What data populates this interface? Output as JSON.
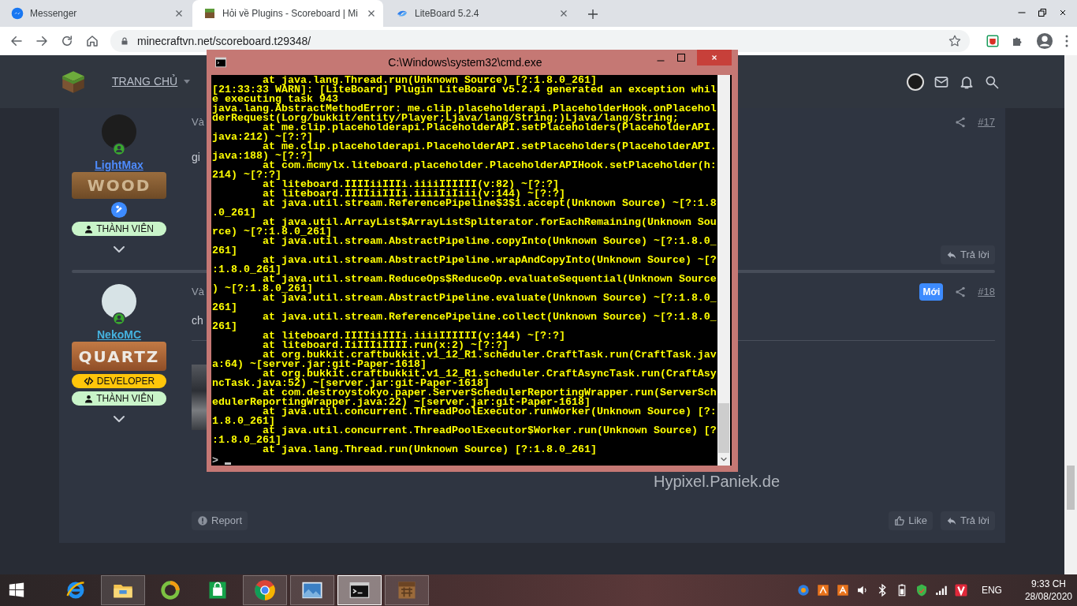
{
  "browser": {
    "tabs": [
      {
        "title": "Messenger",
        "selected": false
      },
      {
        "title": "Hỏi về Plugins - Scoreboard | Mi",
        "selected": true
      },
      {
        "title": "LiteBoard 5.2.4",
        "selected": false
      }
    ],
    "url": "minecraftvn.net/scoreboard.t29348/"
  },
  "site": {
    "nav_items": [
      {
        "label": "TRANG CHỦ"
      }
    ]
  },
  "posts": [
    {
      "author": "LightMax",
      "color": "#4e8cff",
      "online": true,
      "banner": {
        "kind": "wood",
        "text": "WOOD"
      },
      "writer_icon": true,
      "badges": [
        {
          "kind": "member",
          "label": "THÀNH VIÊN"
        }
      ],
      "meta": "Và",
      "is_new": false,
      "number": "#17",
      "body": "gi",
      "attachment_image": false,
      "actions": [
        {
          "kind": "reply",
          "label": "Trả lời"
        }
      ]
    },
    {
      "author": "NekoMC",
      "color": "#45b3e0",
      "online": true,
      "banner": {
        "kind": "quartz",
        "text": "QUARTZ"
      },
      "writer_icon": false,
      "badges": [
        {
          "kind": "developer",
          "label": "DEVELOPER"
        },
        {
          "kind": "member",
          "label": "THÀNH VIÊN"
        }
      ],
      "meta": "Và",
      "is_new": true,
      "new_label": "Mới",
      "number": "#18",
      "body": "ch",
      "attachment_image": true,
      "signature": "Hypixel.Paniek.de",
      "actions": [
        {
          "kind": "report",
          "label": "Report"
        },
        {
          "kind": "like",
          "label": "Like"
        },
        {
          "kind": "reply",
          "label": "Trả lời"
        }
      ]
    }
  ],
  "console_window": {
    "title": "C:\\Windows\\system32\\cmd.exe",
    "prompt": ">",
    "lines": [
      {
        "text": "at java.lang.Thread.run(Unknown Source) [?:1.8.0_261]",
        "indented": true
      },
      {
        "text": "[21:33:33 WARN]: [LiteBoard] Plugin LiteBoard v5.2.4 generated an exception whil",
        "indented": false
      },
      {
        "text": "e executing task 943",
        "indented": false
      },
      {
        "text": "java.lang.AbstractMethodError: me.clip.placeholderapi.PlaceholderHook.onPlacehol",
        "indented": false
      },
      {
        "text": "derRequest(Lorg/bukkit/entity/Player;Ljava/lang/String;)Ljava/lang/String;",
        "indented": false
      },
      {
        "text": "at me.clip.placeholderapi.PlaceholderAPI.setPlaceholders(PlaceholderAPI.",
        "indented": true
      },
      {
        "text": "java:212) ~[?:?]",
        "indented": false
      },
      {
        "text": "at me.clip.placeholderapi.PlaceholderAPI.setPlaceholders(PlaceholderAPI.",
        "indented": true
      },
      {
        "text": "java:188) ~[?:?]",
        "indented": false
      },
      {
        "text": "at com.mcmylx.liteboard.placeholder.PlaceholderAPIHook.setPlaceholder(h:",
        "indented": true
      },
      {
        "text": "214) ~[?:?]",
        "indented": false
      },
      {
        "text": "at liteboard.IIIIiiIIIi.iiiiIIIIII(v:82) ~[?:?]",
        "indented": true
      },
      {
        "text": "at liteboard.IIIIiiIIIi.iiiiIiIiii(v:144) ~[?:?]",
        "indented": true
      },
      {
        "text": "at java.util.stream.ReferencePipeline$3$1.accept(Unknown Source) ~[?:1.8",
        "indented": true
      },
      {
        "text": ".0_261]",
        "indented": false
      },
      {
        "text": "at java.util.ArrayList$ArrayListSpliterator.forEachRemaining(Unknown Sou",
        "indented": true
      },
      {
        "text": "rce) ~[?:1.8.0_261]",
        "indented": false
      },
      {
        "text": "at java.util.stream.AbstractPipeline.copyInto(Unknown Source) ~[?:1.8.0_",
        "indented": true
      },
      {
        "text": "261]",
        "indented": false
      },
      {
        "text": "at java.util.stream.AbstractPipeline.wrapAndCopyInto(Unknown Source) ~[?",
        "indented": true
      },
      {
        "text": ":1.8.0_261]",
        "indented": false
      },
      {
        "text": "at java.util.stream.ReduceOps$ReduceOp.evaluateSequential(Unknown Source",
        "indented": true
      },
      {
        "text": ") ~[?:1.8.0_261]",
        "indented": false
      },
      {
        "text": "at java.util.stream.AbstractPipeline.evaluate(Unknown Source) ~[?:1.8.0_",
        "indented": true
      },
      {
        "text": "261]",
        "indented": false
      },
      {
        "text": "at java.util.stream.ReferencePipeline.collect(Unknown Source) ~[?:1.8.0_",
        "indented": true
      },
      {
        "text": "261]",
        "indented": false
      },
      {
        "text": "at liteboard.IIIIiiIIIi.iiiiIIIIII(v:144) ~[?:?]",
        "indented": true
      },
      {
        "text": "at liteboard.IiIIIiIIII.run(x:2) ~[?:?]",
        "indented": true
      },
      {
        "text": "at org.bukkit.craftbukkit.v1_12_R1.scheduler.CraftTask.run(CraftTask.jav",
        "indented": true
      },
      {
        "text": "a:64) ~[server.jar:git-Paper-1618]",
        "indented": false
      },
      {
        "text": "at org.bukkit.craftbukkit.v1_12_R1.scheduler.CraftAsyncTask.run(CraftAsy",
        "indented": true
      },
      {
        "text": "ncTask.java:52) ~[server.jar:git-Paper-1618]",
        "indented": false
      },
      {
        "text": "at com.destroystokyo.paper.ServerSchedulerReportingWrapper.run(ServerSch",
        "indented": true
      },
      {
        "text": "edulerReportingWrapper.java:22) ~[server.jar:git-Paper-1618]",
        "indented": false
      },
      {
        "text": "at java.util.concurrent.ThreadPoolExecutor.runWorker(Unknown Source) [?:",
        "indented": true
      },
      {
        "text": "1.8.0_261]",
        "indented": false
      },
      {
        "text": "at java.util.concurrent.ThreadPoolExecutor$Worker.run(Unknown Source) [?",
        "indented": true
      },
      {
        "text": ":1.8.0_261]",
        "indented": false
      },
      {
        "text": "at java.lang.Thread.run(Unknown Source) [?:1.8.0_261]",
        "indented": true
      }
    ]
  },
  "taskbar": {
    "apps": [
      {
        "kind": "ie",
        "running": false,
        "selected": false
      },
      {
        "kind": "explorer",
        "running": true,
        "selected": false
      },
      {
        "kind": "ring",
        "running": false,
        "selected": false
      },
      {
        "kind": "store",
        "running": false,
        "selected": false
      },
      {
        "kind": "chrome",
        "running": true,
        "selected": false
      },
      {
        "kind": "photos",
        "running": true,
        "selected": false
      },
      {
        "kind": "cmd",
        "running": true,
        "selected": true
      },
      {
        "kind": "crate",
        "running": true,
        "selected": false
      }
    ],
    "tray_icons": [
      {
        "kind": "blue-circle"
      },
      {
        "kind": "orange-a"
      },
      {
        "kind": "orange-b"
      },
      {
        "kind": "volume"
      },
      {
        "kind": "bluetooth"
      },
      {
        "kind": "battery"
      },
      {
        "kind": "shield"
      },
      {
        "kind": "signal"
      },
      {
        "kind": "v-logo"
      }
    ],
    "language": "ENG",
    "time": "9:33 CH",
    "date": "28/08/2020"
  }
}
